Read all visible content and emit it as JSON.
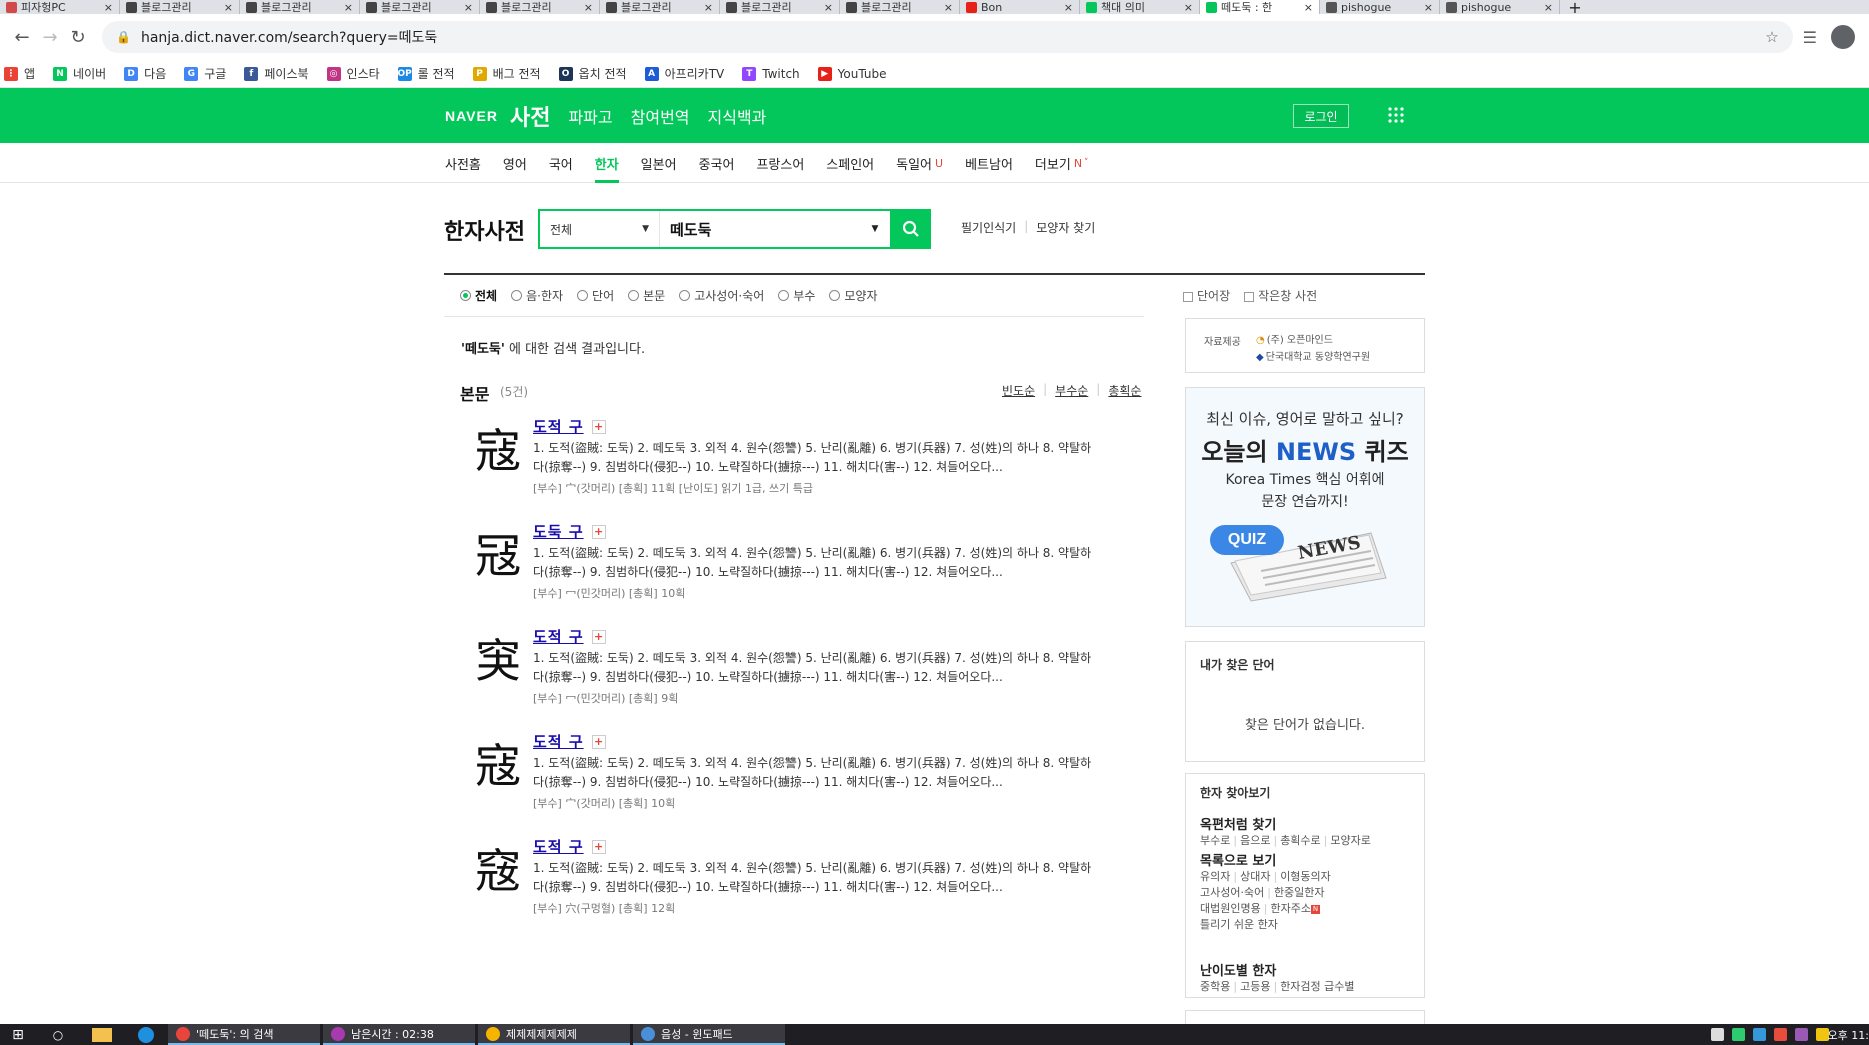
{
  "browser": {
    "tabs": [
      {
        "title": "피자헝PC",
        "color": "#d14b4b"
      },
      {
        "title": "블로그관리",
        "color": "#444"
      },
      {
        "title": "블로그관리",
        "color": "#444"
      },
      {
        "title": "블로그관리",
        "color": "#444"
      },
      {
        "title": "블로그관리",
        "color": "#444"
      },
      {
        "title": "블로그관리",
        "color": "#444"
      },
      {
        "title": "블로그관리",
        "color": "#444"
      },
      {
        "title": "블로그관리",
        "color": "#444"
      },
      {
        "title": "Bon",
        "color": "#e62117"
      },
      {
        "title": "책대 의미",
        "color": "#03c75a"
      },
      {
        "title": "떼도둑 : 한",
        "color": "#03c75a",
        "active": true
      },
      {
        "title": "pishogue",
        "color": "#555"
      },
      {
        "title": "pishogue",
        "color": "#555"
      }
    ],
    "url": "hanja.dict.naver.com/search?query=떼도둑",
    "bookmarks": [
      {
        "label": "앱",
        "color": "#ea4335",
        "glyph": "⋮"
      },
      {
        "label": "네이버",
        "color": "#03c75a",
        "glyph": "N"
      },
      {
        "label": "다음",
        "color": "#4285f4",
        "glyph": "D"
      },
      {
        "label": "구글",
        "color": "#4285f4",
        "glyph": "G"
      },
      {
        "label": "페이스북",
        "color": "#3b5998",
        "glyph": "f"
      },
      {
        "label": "인스타",
        "color": "#c13584",
        "glyph": "◎"
      },
      {
        "label": "롤 전적",
        "color": "#1e88e5",
        "glyph": "OP"
      },
      {
        "label": "배그 전적",
        "color": "#e0a800",
        "glyph": "P"
      },
      {
        "label": "옵치 전적",
        "color": "#1d3557",
        "glyph": "O"
      },
      {
        "label": "아프리카TV",
        "color": "#1e5bd6",
        "glyph": "A"
      },
      {
        "label": "Twitch",
        "color": "#9146ff",
        "glyph": "T"
      },
      {
        "label": "YouTube",
        "color": "#e62117",
        "glyph": "▶"
      }
    ]
  },
  "header": {
    "logo": "NAVER",
    "brand": "사전",
    "links": [
      "파파고",
      "참여번역",
      "지식백과"
    ],
    "login": "로그인"
  },
  "subnav": {
    "items": [
      "사전홈",
      "영어",
      "국어",
      "한자",
      "일본어",
      "중국어",
      "프랑스어",
      "스페인어",
      "독일어",
      "베트남어",
      "더보기"
    ],
    "active_index": 3,
    "badge_de": "U",
    "badge_more": "N"
  },
  "search": {
    "title": "한자사전",
    "scope": "전체",
    "query": "떼도둑",
    "tool1": "필기인식기",
    "tool2": "모양자 찾기"
  },
  "filters": [
    "전체",
    "음·한자",
    "단어",
    "본문",
    "고사성어·숙어",
    "부수",
    "모양자"
  ],
  "result_message": {
    "q": "'떼도둑'",
    "suffix": " 에 대한 검색 결과입니다."
  },
  "section": {
    "title": "본문",
    "count": "(5건)",
    "sorts": [
      "빈도순",
      "부수순",
      "총획순"
    ]
  },
  "entries": [
    {
      "glyph": "寇",
      "headword": "도적 구",
      "def1": "1. 도적(盜賊: 도둑) 2. 떼도둑 3. 외적 4. 원수(怨讐) 5. 난리(亂離) 6. 병기(兵器) 7. 성(姓)의 하나 8. 약탈하",
      "def2": "다(掠奪--) 9. 침범하다(侵犯--) 10. 노략질하다(擄掠---) 11. 해치다(害--) 12. 쳐들어오다...",
      "meta": "[부수] 宀(갓머리)  [총획] 11획  [난이도] 읽기 1급, 쓰기 특급"
    },
    {
      "glyph": "冦",
      "headword": "도둑 구",
      "def1": "1. 도적(盜賊: 도둑) 2. 떼도둑 3. 외적 4. 원수(怨讐) 5. 난리(亂離) 6. 병기(兵器) 7. 성(姓)의 하나 8. 약탈하",
      "def2": "다(掠奪--) 9. 침범하다(侵犯--) 10. 노략질하다(擄掠---) 11. 해치다(害--) 12. 쳐들어오다...",
      "meta": "[부수] 冖(민갓머리)  [총획] 10획"
    },
    {
      "glyph": "䆕",
      "headword": "도적 구",
      "def1": "1. 도적(盜賊: 도둑) 2. 떼도둑 3. 외적 4. 원수(怨讐) 5. 난리(亂離) 6. 병기(兵器) 7. 성(姓)의 하나 8. 약탈하",
      "def2": "다(掠奪--) 9. 침범하다(侵犯--) 10. 노략질하다(擄掠---) 11. 해치다(害--) 12. 쳐들어오다...",
      "meta": "[부수] 冖(민갓머리)  [총획] 9획"
    },
    {
      "glyph": "寇",
      "headword": "도적 구",
      "def1": "1. 도적(盜賊: 도둑) 2. 떼도둑 3. 외적 4. 원수(怨讐) 5. 난리(亂離) 6. 병기(兵器) 7. 성(姓)의 하나 8. 약탈하",
      "def2": "다(掠奪--) 9. 침범하다(侵犯--) 10. 노략질하다(擄掠---) 11. 해치다(害--) 12. 쳐들어오다...",
      "meta": "[부수] 宀(갓머리)  [총획] 10획"
    },
    {
      "glyph": "窛",
      "headword": "도적 구",
      "def1": "1. 도적(盜賊: 도둑) 2. 떼도둑 3. 외적 4. 원수(怨讐) 5. 난리(亂離) 6. 병기(兵器) 7. 성(姓)의 하나 8. 약탈하",
      "def2": "다(掠奪--) 9. 침범하다(侵犯--) 10. 노략질하다(擄掠---) 11. 해치다(害--) 12. 쳐들어오다...",
      "meta": "[부수] 穴(구멍혈)  [총획] 12획"
    }
  ],
  "sidebar": {
    "top1": "단어장",
    "top2": "작은창 사전",
    "provider_label": "자료제공",
    "provider1": "(주) 오픈마인드",
    "provider2": "단국대학교 동양학연구원",
    "ad": {
      "line1": "최신 이슈, 영어로 말하고 싶니?",
      "line2a": "오늘의 ",
      "line2b": "NEWS",
      "line2c": " 퀴즈",
      "line3": "Korea Times 핵심 어휘에",
      "line4": "문장 연습까지!",
      "quiz": "QUIZ",
      "news": "NEWS"
    },
    "found_title": "내가 찾은 단어",
    "found_empty": "찾은 단어가 없습니다.",
    "find_title": "한자 찾아보기",
    "g1_title": "옥편처럼 찾기",
    "g1_links": [
      "부수로",
      "음으로",
      "총획수로",
      "모양자로"
    ],
    "g2_title": "목록으로 보기",
    "g2_row1": [
      "유의자",
      "상대자",
      "이형동의자"
    ],
    "g2_row2": [
      "고사성어·숙어",
      "한중일한자"
    ],
    "g2_row3": [
      "대법원인명용",
      "한자주소"
    ],
    "g2_row4": "틀리기 쉬운 한자",
    "g3_title": "난이도별 한자",
    "g3_links": [
      "중학용",
      "고등용",
      "한자검정 급수별"
    ]
  },
  "taskbar": {
    "items": [
      {
        "label": "'떼도둑': 의 검색",
        "color": "#e8453c"
      },
      {
        "label": "남은시간 : 02:38",
        "color": "#a83ab0"
      },
      {
        "label": "제제제제제제제",
        "color": "#f4b400"
      },
      {
        "label": "음성 - 윈도패드",
        "color": "#4a90d9"
      }
    ],
    "clock": "오후 11:"
  }
}
